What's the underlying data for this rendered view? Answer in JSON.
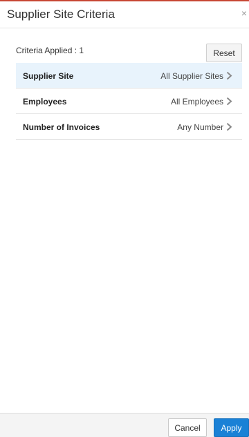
{
  "header": {
    "title": "Supplier Site Criteria",
    "close_glyph": "×"
  },
  "criteria": {
    "applied_text": "Criteria Applied : 1",
    "reset_label": "Reset"
  },
  "filters": [
    {
      "label": "Supplier Site",
      "value": "All Supplier Sites",
      "selected": true
    },
    {
      "label": "Employees",
      "value": "All Employees",
      "selected": false
    },
    {
      "label": "Number of Invoices",
      "value": "Any Number",
      "selected": false
    }
  ],
  "footer": {
    "cancel_label": "Cancel",
    "apply_label": "Apply"
  },
  "colors": {
    "accent": "#1a81d6",
    "top_bar": "#c74634",
    "selected_row": "#e8f3fc"
  },
  "icons": {
    "close": "close-icon",
    "row_chevron": "chevron-right-icon"
  }
}
